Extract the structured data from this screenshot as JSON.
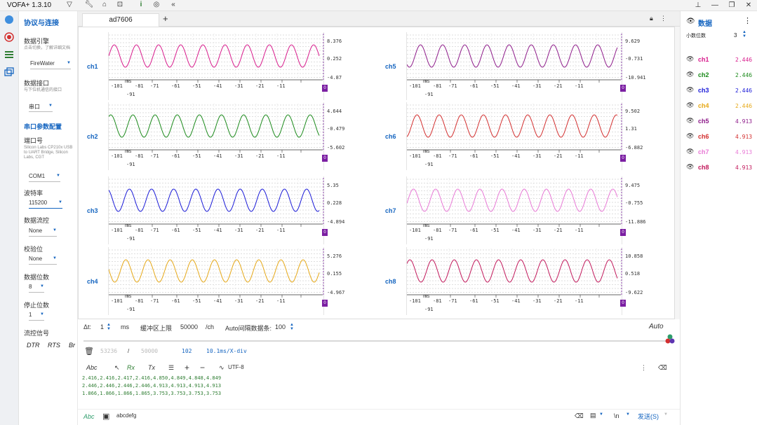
{
  "app": {
    "title": "VOFA+ 1.3.10"
  },
  "left": {
    "section_title": "协议与连接",
    "engine_label": "数据引擎",
    "engine_hint": "点击切换，了解详细文档",
    "engine_value": "FireWater",
    "interface_label": "数据接口",
    "interface_hint": "与下位机通信的接口",
    "interface_value": "串口",
    "serial_title": "串口参数配置",
    "port_label": "端口号",
    "port_desc": "Silicon Labs CP210x USB to UART Bridge, Silicon Labs, CGT",
    "port_value": "COM1",
    "baud_label": "波特率",
    "baud_value": "115200",
    "flowctl_label": "数据流控",
    "flowctl_value": "None",
    "parity_label": "校验位",
    "parity_value": "None",
    "databits_label": "数据位数",
    "databits_value": "8",
    "stopbits_label": "停止位数",
    "stopbits_value": "1",
    "flow_title": "流控信号",
    "dtr": "DTR",
    "rts": "RTS",
    "br": "Br"
  },
  "tab": {
    "name": "ad7606"
  },
  "xaxis": {
    "ticks": [
      "-101",
      "-81",
      "-71",
      "-61",
      "-51",
      "-41",
      "-31",
      "-21",
      "-11"
    ],
    "sub": "-91",
    "unit": "ms",
    "tag": "0"
  },
  "channels": [
    {
      "name": "ch1",
      "color": "#d81b8c",
      "ymax": "8.376",
      "ymid": "0.252",
      "ymin": "-4.87"
    },
    {
      "name": "ch2",
      "color": "#1b8a1b",
      "ymax": "4.644",
      "ymid": "-0.479",
      "ymin": "-5.602"
    },
    {
      "name": "ch3",
      "color": "#1a1ad8",
      "ymax": "5.35",
      "ymid": "0.228",
      "ymin": "-4.894"
    },
    {
      "name": "ch4",
      "color": "#e6a817",
      "ymax": "5.276",
      "ymid": "0.155",
      "ymin": "-4.967"
    },
    {
      "name": "ch5",
      "color": "#8e1b8a",
      "ymax": "9.629",
      "ymid": "-0.731",
      "ymin": "-10.941"
    },
    {
      "name": "ch6",
      "color": "#d32f2f",
      "ymax": "9.502",
      "ymid": "1.31",
      "ymin": "-6.882"
    },
    {
      "name": "ch7",
      "color": "#e879d6",
      "ymax": "9.475",
      "ymid": "-0.755",
      "ymin": "-11.886"
    },
    {
      "name": "ch8",
      "color": "#c2185b",
      "ymax": "10.858",
      "ymid": "0.518",
      "ymin": "-9.622"
    }
  ],
  "controls": {
    "dt_label": "Δt:",
    "dt_value": "1",
    "dt_unit": "ms",
    "buffer_label": "缓冲区上限",
    "buffer_value": "50000",
    "buffer_unit": "/ch",
    "auto_label": "Auto间隔数据条:",
    "auto_value": "100",
    "auto_mode": "Auto"
  },
  "recvbar": {
    "count": "53236",
    "sep": "/",
    "total": "50000",
    "n": "102",
    "scale": "10.1ms/X-div"
  },
  "recvtools": {
    "abc": "Abc",
    "rx": "Rx",
    "tx": "Tx",
    "encoding": "UTF-8"
  },
  "recv_lines": [
    "2.416,2.416,2.417,2.416,4.850,4.849,4.848,4.849",
    "2.446,2.446,2.446,2.446,4.913,4.913,4.913,4.913",
    "1.866,1.866,1.866,1.865,3.753,3.753,3.753,3.753"
  ],
  "send": {
    "abc": "Abc",
    "input": "abcdefg",
    "newline": "\\n",
    "button": "发送(S)"
  },
  "right": {
    "title": "数据",
    "decimals_label": "小数位数",
    "decimals_value": "3",
    "items": [
      {
        "name": "ch1",
        "value": "2.446",
        "color": "#d81b8c"
      },
      {
        "name": "ch2",
        "value": "2.446",
        "color": "#1b8a1b"
      },
      {
        "name": "ch3",
        "value": "2.446",
        "color": "#1a1ad8"
      },
      {
        "name": "ch4",
        "value": "2.446",
        "color": "#e6a817"
      },
      {
        "name": "ch5",
        "value": "4.913",
        "color": "#8e1b8a"
      },
      {
        "name": "ch6",
        "value": "4.913",
        "color": "#d32f2f"
      },
      {
        "name": "ch7",
        "value": "4.913",
        "color": "#e879d6"
      },
      {
        "name": "ch8",
        "value": "4.913",
        "color": "#c2185b"
      }
    ]
  }
}
